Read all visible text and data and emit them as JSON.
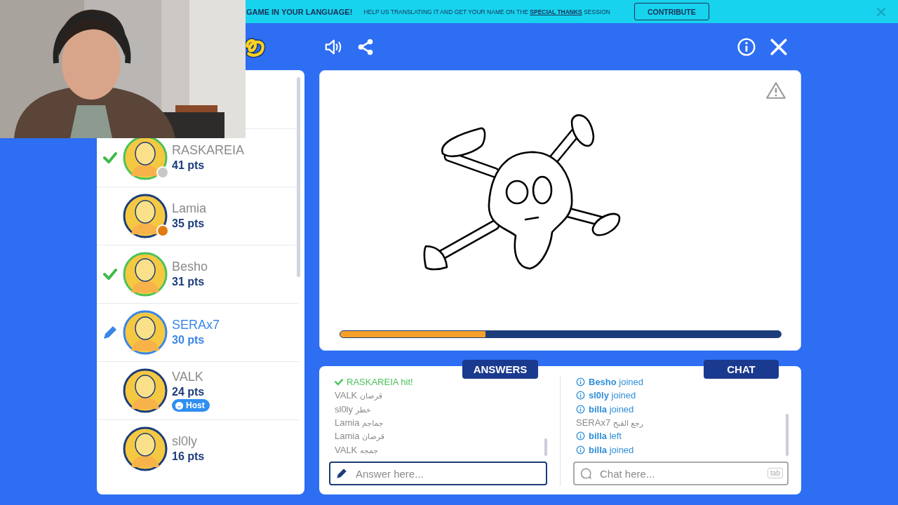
{
  "banner": {
    "title": "GAME IN YOUR LANGUAGE!",
    "text": "HELP US TRANSLATING IT AND GET YOUR NAME ON THE **SPECIAL THANKS** SESSION",
    "button": "CONTRIBUTE"
  },
  "players": [
    {
      "name": "RASKAREIA",
      "points": "41 pts",
      "guessed": true,
      "drawing": false,
      "color": "#c8c8c8"
    },
    {
      "name": "Lamia",
      "points": "35 pts",
      "guessed": false,
      "drawing": false,
      "color": "#e07b10"
    },
    {
      "name": "Besho",
      "points": "31 pts",
      "guessed": true,
      "drawing": false
    },
    {
      "name": "SERAx7",
      "points": "30 pts",
      "guessed": false,
      "drawing": true
    },
    {
      "name": "VALK",
      "points": "24 pts",
      "guessed": false,
      "drawing": false,
      "badge": "Host"
    },
    {
      "name": "sl0ly",
      "points": "16 pts",
      "guessed": false,
      "drawing": false
    }
  ],
  "canvas": {
    "progress": {
      "level": 0.33
    }
  },
  "answers": {
    "tab": "ANSWERS",
    "placeholder": "Answer here...",
    "entries": [
      {
        "kind": "hit",
        "name": "RASKAREIA",
        "text": "hit!"
      },
      {
        "kind": "guess",
        "name": "VALK",
        "text": "قرصان"
      },
      {
        "kind": "guess",
        "name": "sl0ly",
        "text": "خطر"
      },
      {
        "kind": "guess",
        "name": "Lamia",
        "text": "جماجم"
      },
      {
        "kind": "guess",
        "name": "Lamia",
        "text": "قرصان"
      },
      {
        "kind": "guess",
        "name": "VALK",
        "text": "جمجه"
      }
    ]
  },
  "chat": {
    "tab": "CHAT",
    "placeholder": "Chat here...",
    "key_hint": "tab",
    "entries": [
      {
        "kind": "system",
        "name": "Besho",
        "text": "joined"
      },
      {
        "kind": "system",
        "name": "sl0ly",
        "text": "joined"
      },
      {
        "kind": "system",
        "name": "billa",
        "text": "joined"
      },
      {
        "kind": "message",
        "name": "SERAx7",
        "text": "رجع القبح"
      },
      {
        "kind": "system",
        "name": "billa",
        "text": "left"
      },
      {
        "kind": "system",
        "name": "billa",
        "text": "joined"
      }
    ]
  }
}
